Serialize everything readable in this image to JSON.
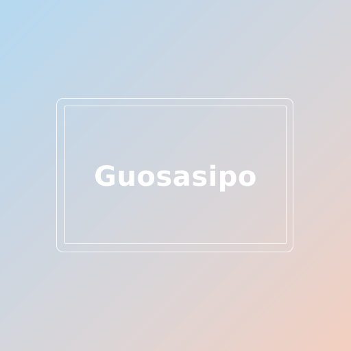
{
  "card": {
    "title": "Guosasipo"
  },
  "colors": {
    "gradient_start": "#b5d9f1",
    "gradient_mid": "#dcd5d6",
    "gradient_end": "#f3cfc0",
    "frame": "#ffffff",
    "text": "#ffffff"
  }
}
